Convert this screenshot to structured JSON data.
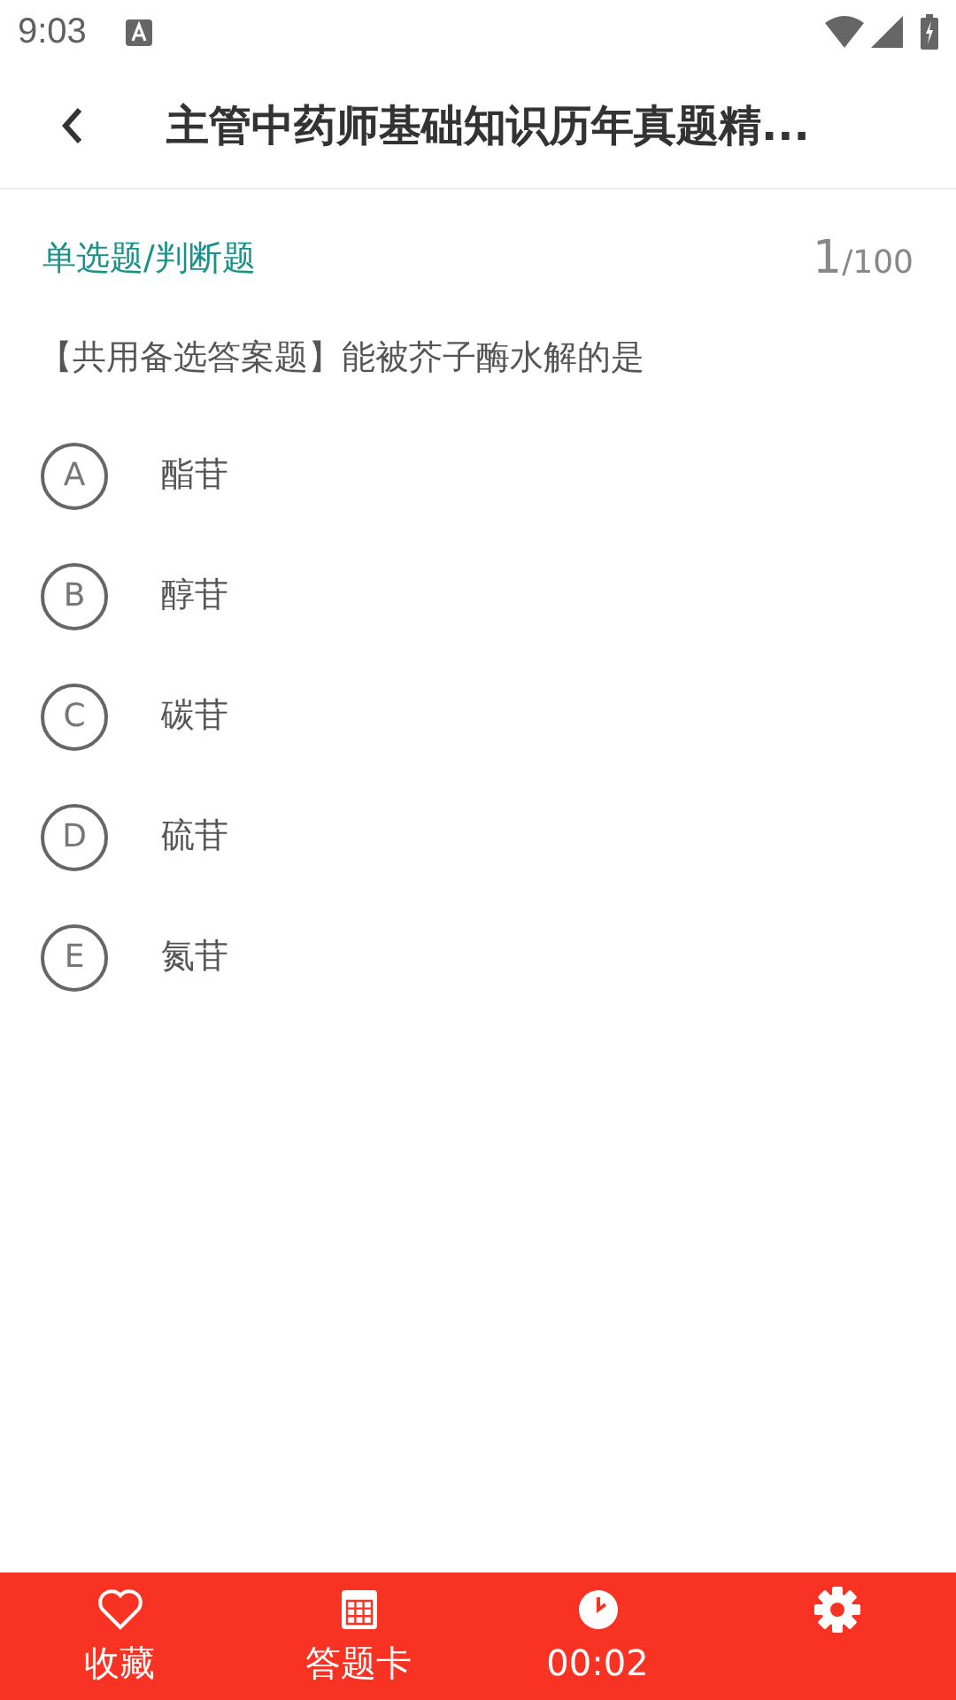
{
  "status_bar": {
    "time": "9:03"
  },
  "header": {
    "title": "主管中药师基础知识历年真题精..."
  },
  "question": {
    "type": "单选题/判断题",
    "current": "1",
    "total": "/100",
    "text": "【共用备选答案题】能被芥子酶水解的是",
    "options": [
      {
        "letter": "A",
        "text": "酯苷",
        "selected": false
      },
      {
        "letter": "B",
        "text": "醇苷",
        "selected": false
      },
      {
        "letter": "C",
        "text": "碳苷",
        "selected": false
      },
      {
        "letter": "D",
        "text": "硫苷",
        "selected": false
      },
      {
        "letter": "E",
        "text": "氮苷",
        "selected": false
      }
    ]
  },
  "bottom_bar": [
    {
      "kind": "favorite",
      "label": "收藏"
    },
    {
      "kind": "card",
      "label": "答题卡"
    },
    {
      "kind": "timer",
      "label": "00:02"
    },
    {
      "kind": "settings"
    }
  ]
}
